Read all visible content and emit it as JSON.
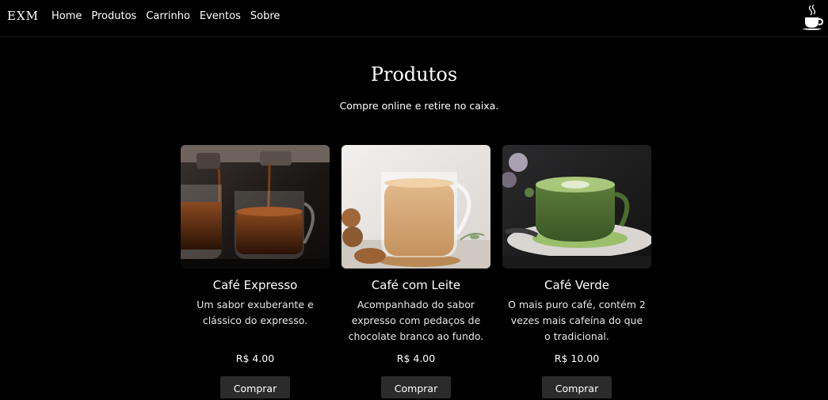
{
  "nav": {
    "logo": "EXM",
    "links": [
      "Home",
      "Produtos",
      "Carrinho",
      "Eventos",
      "Sobre"
    ],
    "cart_icon": "coffee-cup-icon"
  },
  "page": {
    "title": "Produtos",
    "subtitle": "Compre online e retire no caixa."
  },
  "products": [
    {
      "name": "Café Expresso",
      "description": "Um sabor exuberante e clássico do expresso.",
      "price": "R$ 4.00",
      "button": "Comprar"
    },
    {
      "name": "Café com Leite",
      "description": "Acompanhado do sabor expresso com pedaços de chocolate branco ao fundo.",
      "price": "R$ 4.00",
      "button": "Comprar"
    },
    {
      "name": "Café Verde",
      "description": "O mais puro café, contém 2 vezes mais cafeína do que o tradicional.",
      "price": "R$ 10.00",
      "button": "Comprar"
    }
  ]
}
